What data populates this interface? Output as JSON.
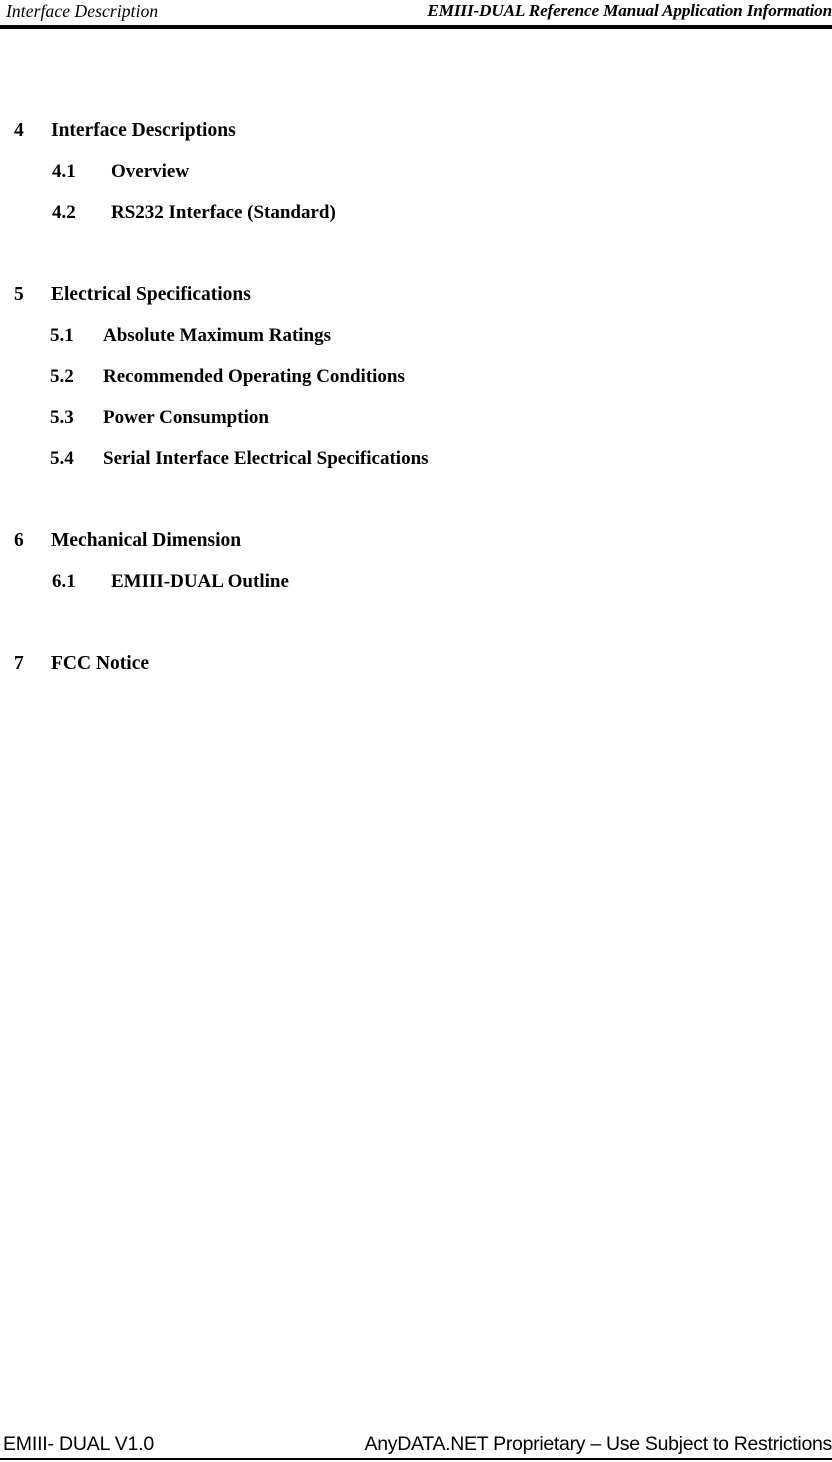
{
  "page": {
    "background_color": "#ffffff",
    "text_color": "#000000"
  },
  "header": {
    "left_text": "Interface Description",
    "right_text": "EMIII-DUAL Reference Manual Application Information"
  },
  "toc": {
    "groups": [
      {
        "chapter": {
          "number": "4",
          "title": "Interface Descriptions"
        },
        "sections": [
          {
            "number": "4.1",
            "title": "Overview"
          },
          {
            "number": "4.2",
            "title": "RS232 Interface (Standard)"
          }
        ]
      },
      {
        "chapter": {
          "number": "5",
          "title": "Electrical Specifications"
        },
        "sections": [
          {
            "number": "5.1",
            "title": "Absolute Maximum Ratings"
          },
          {
            "number": "5.2",
            "title": "Recommended Operating Conditions"
          },
          {
            "number": "5.3",
            "title": "Power Consumption"
          },
          {
            "number": "5.4",
            "title": "Serial Interface Electrical Specifications"
          }
        ]
      },
      {
        "chapter": {
          "number": "6",
          "title": "Mechanical Dimension"
        },
        "sections": [
          {
            "number": "6.1",
            "title": "EMIII-DUAL Outline"
          }
        ]
      },
      {
        "chapter": {
          "number": "7",
          "title": "FCC Notice"
        },
        "sections": []
      }
    ]
  },
  "footer": {
    "left_text": "EMIII- DUAL V1.0",
    "right_text": "AnyDATA.NET Proprietary – Use Subject to Restrictions"
  }
}
